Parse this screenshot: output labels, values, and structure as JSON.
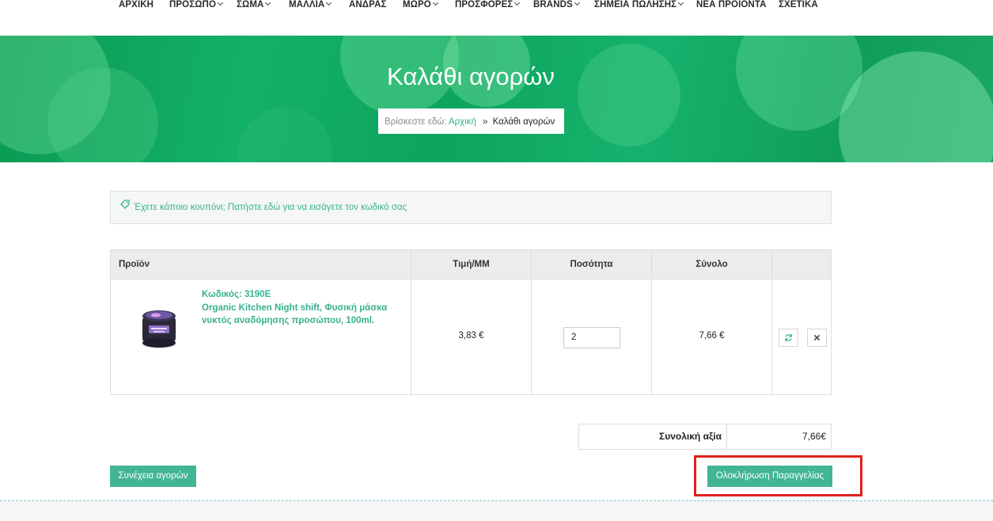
{
  "nav": {
    "items": [
      {
        "label": "ΑΡΧΙΚΗ",
        "has_dropdown": false
      },
      {
        "label": "ΠΡΟΣΩΠΟ",
        "has_dropdown": true
      },
      {
        "label": "ΣΩΜΑ",
        "has_dropdown": true
      },
      {
        "label": "ΜΑΛΛΙΑ",
        "has_dropdown": true
      },
      {
        "label": "ΑΝΔΡΑΣ",
        "has_dropdown": false
      },
      {
        "label": "ΜΩΡΟ",
        "has_dropdown": true
      },
      {
        "label": "ΠΡΟΣΦΟΡΕΣ",
        "has_dropdown": true
      },
      {
        "label": "BRANDS",
        "has_dropdown": true
      },
      {
        "label": "ΣΗΜΕΙΑ ΠΩΛΗΣΗΣ",
        "has_dropdown": true
      },
      {
        "label": "ΝΕΑ ΠΡΟΙΟΝΤΑ",
        "has_dropdown": false
      },
      {
        "label": "ΣΧΕΤΙΚΑ",
        "has_dropdown": false
      }
    ]
  },
  "hero": {
    "title": "Καλάθι αγορών",
    "breadcrumb": {
      "prefix": "Βρίσκεστε εδώ:",
      "home": "Αρχική",
      "separator": "»",
      "current": "Καλάθι αγορών"
    }
  },
  "coupon": {
    "icon": "tag-icon",
    "text": "Έχετε κάποιο κουπόνι; Πατήστε εδώ για να εισάγετε τον κωδικό σας"
  },
  "cart": {
    "headers": {
      "product": "Προϊόν",
      "unit_price": "Τιμή/ΜΜ",
      "quantity": "Ποσότητα",
      "total": "Σύνολο"
    },
    "items": [
      {
        "code": "Κωδικός: 3190E",
        "name": "Organic Kitchen Night shift, Φυσική μάσκα νυκτός αναδόμησης προσώπου, 100ml.",
        "unit_price": "3,83 €",
        "quantity": "2",
        "total": "7,66 €"
      }
    ],
    "update_icon": "refresh-icon",
    "remove_icon": "close-icon"
  },
  "summary": {
    "label": "Συνολική αξία",
    "value": "7,66€"
  },
  "actions": {
    "continue_label": "Συνέχεια αγορών",
    "checkout_label": "Ολοκλήρωση Παραγγελίας"
  },
  "colors": {
    "accent": "#42b597",
    "link": "#36b28f",
    "hero_green": "#0fa55d",
    "highlight": "#e0211f"
  }
}
